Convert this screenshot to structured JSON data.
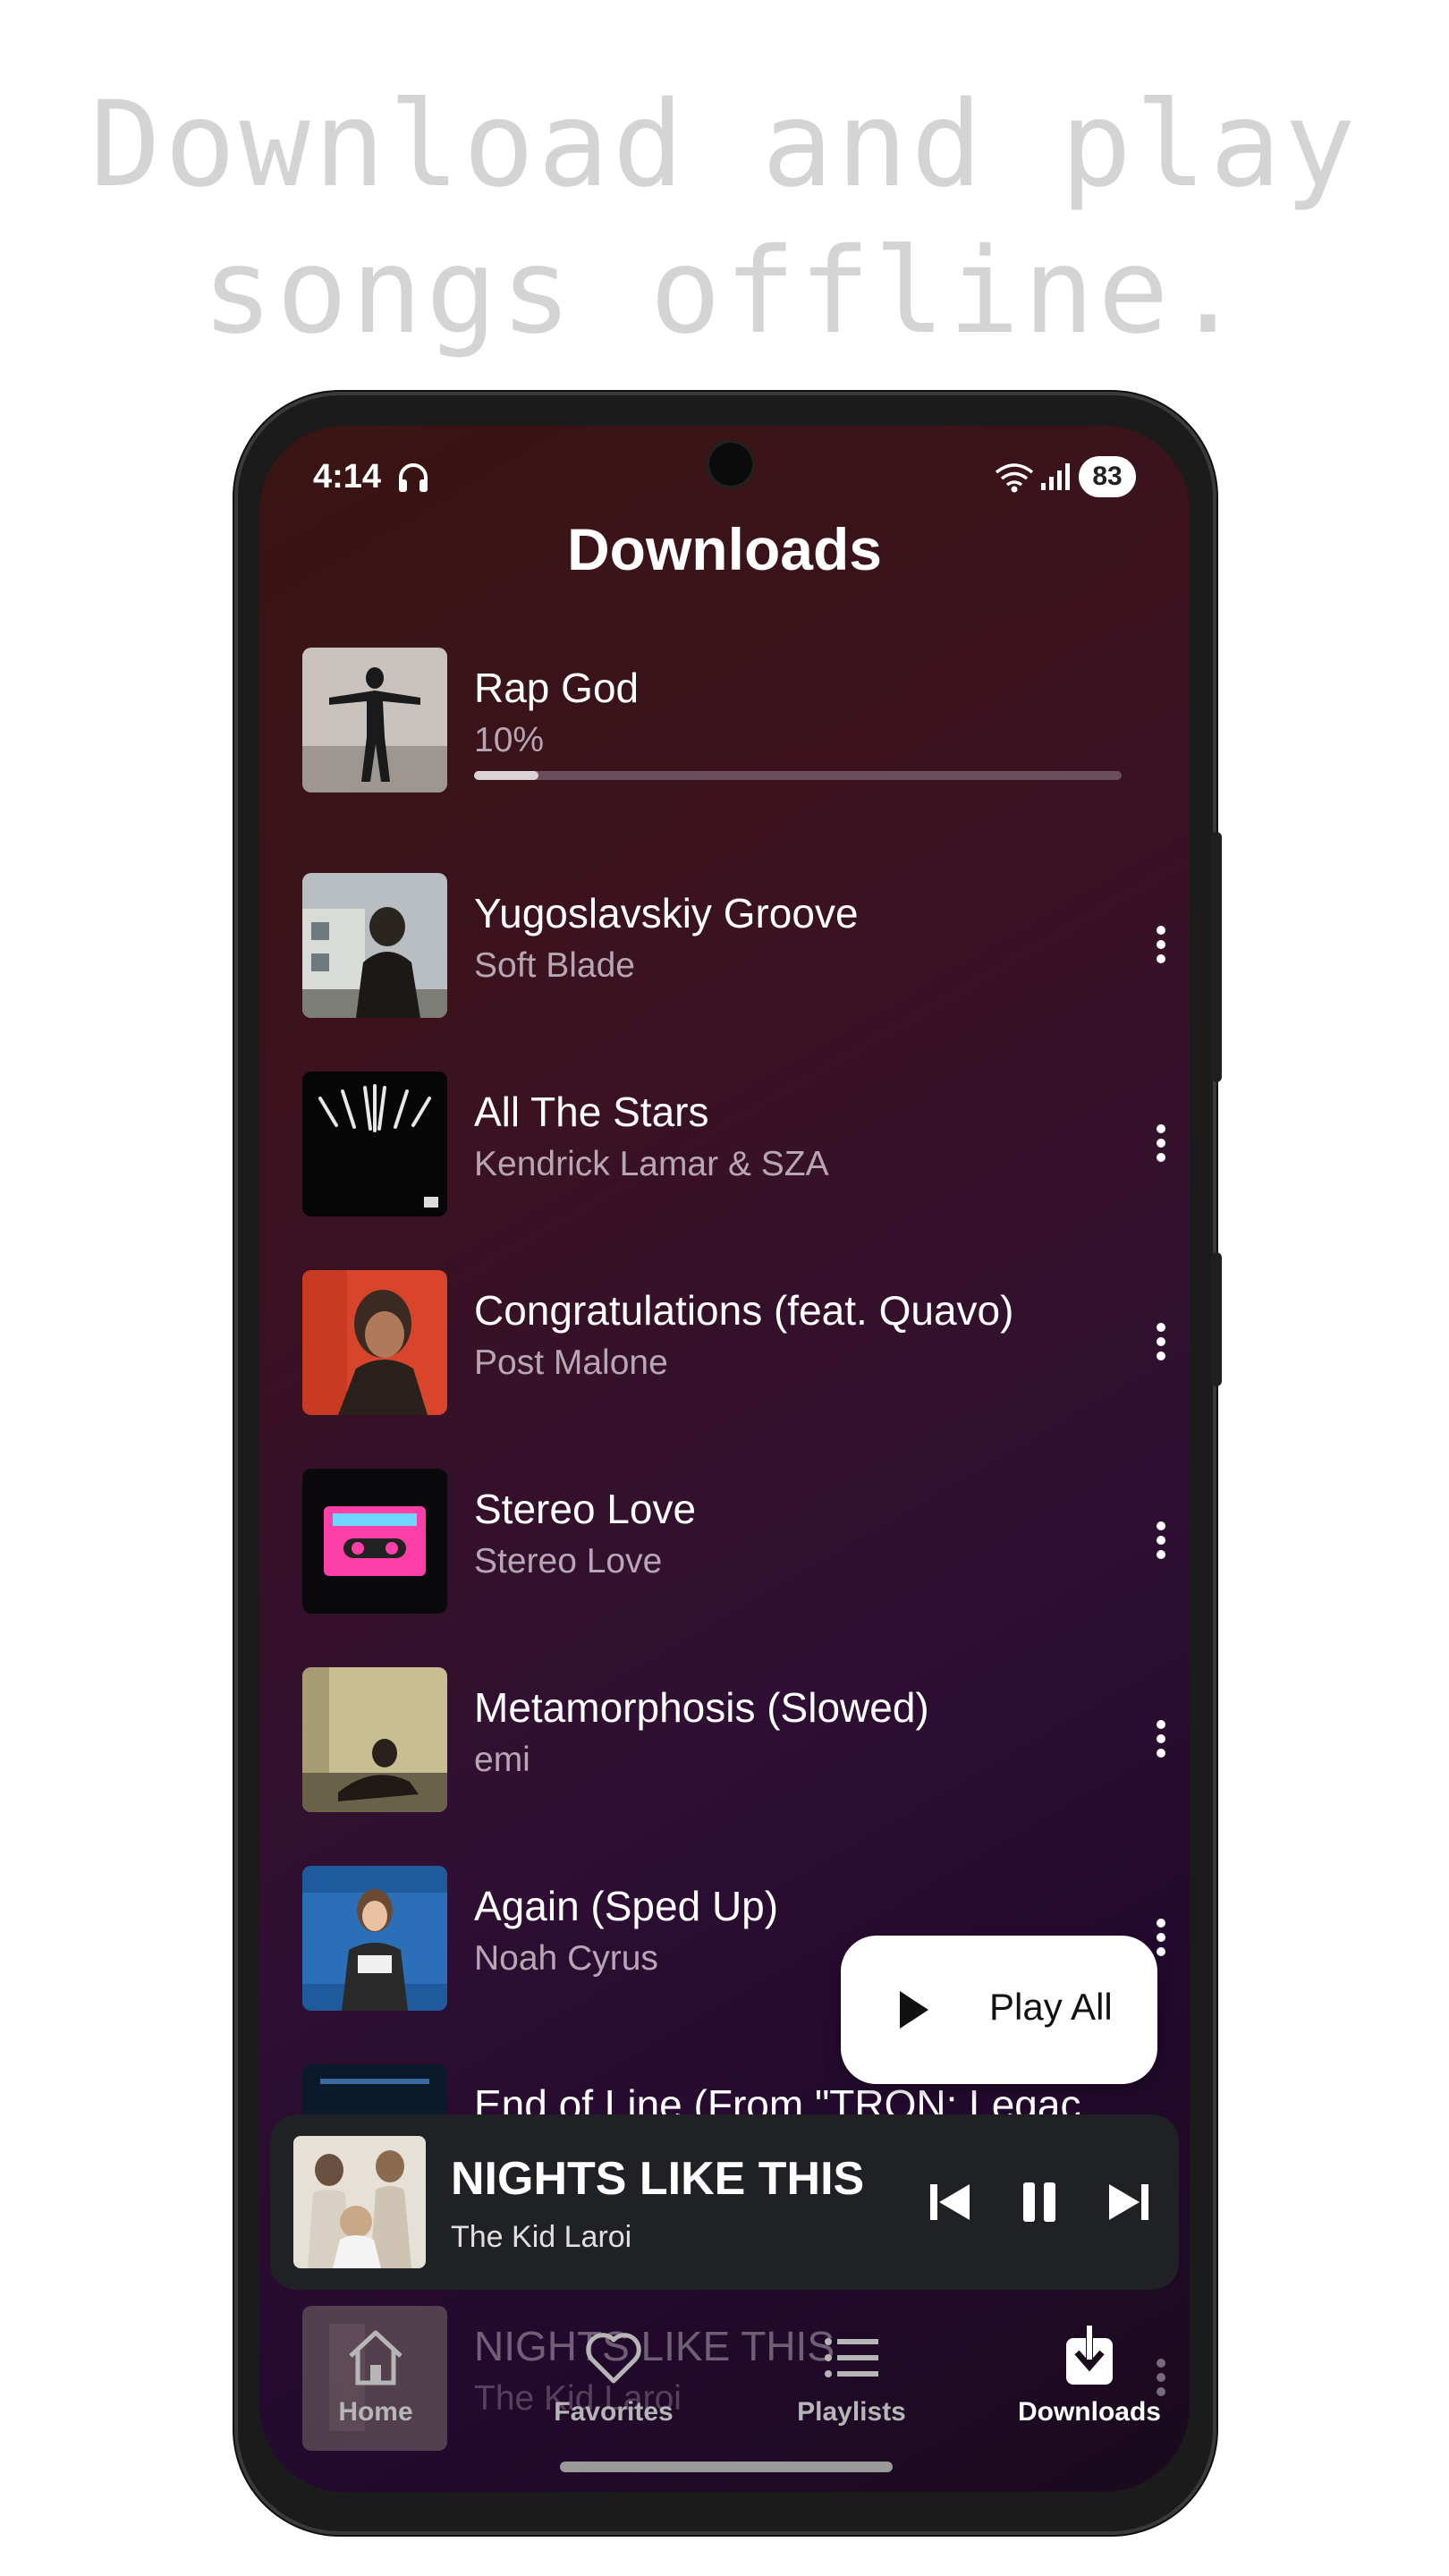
{
  "headline": {
    "line1": "Download and play",
    "line2": "songs offline."
  },
  "status_bar": {
    "time": "4:14",
    "battery": "83"
  },
  "page": {
    "title": "Downloads"
  },
  "downloading": {
    "title": "Rap God",
    "progress_text": "10%",
    "progress_fraction": 0.1
  },
  "songs": [
    {
      "title": "Yugoslavskiy Groove",
      "artist": "Soft Blade"
    },
    {
      "title": "All The Stars",
      "artist": "Kendrick Lamar & SZA"
    },
    {
      "title": "Congratulations (feat. Quavo)",
      "artist": "Post Malone"
    },
    {
      "title": "Stereo Love",
      "artist": "Stereo Love"
    },
    {
      "title": "Metamorphosis (Slowed)",
      "artist": "emi"
    },
    {
      "title": "Again (Sped Up)",
      "artist": "Noah Cyrus"
    },
    {
      "title": "End of Line (From \"TRON: Legac",
      "artist": ""
    },
    {
      "title": "NIGHTS LIKE THIS",
      "artist": "The Kid Laroi"
    }
  ],
  "fab": {
    "label": "Play All"
  },
  "now_playing": {
    "title": "NIGHTS LIKE THIS",
    "artist": "The Kid Laroi"
  },
  "nav": [
    {
      "label": "Home",
      "icon": "home-icon"
    },
    {
      "label": "Favorites",
      "icon": "heart-icon"
    },
    {
      "label": "Playlists",
      "icon": "list-icon"
    },
    {
      "label": "Downloads",
      "icon": "download-icon",
      "active": true
    }
  ],
  "colors": {
    "background_top": "#3a1512",
    "background_bottom": "#23092e",
    "accent": "#ffffff"
  }
}
